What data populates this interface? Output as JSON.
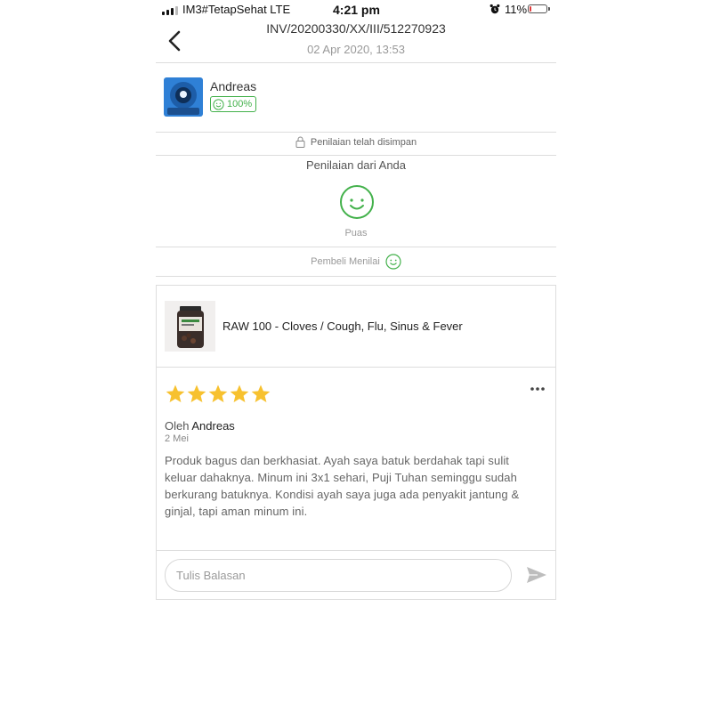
{
  "status_bar": {
    "carrier": "IM3#TetapSehat  LTE",
    "time": "4:21 pm",
    "battery_percent": "11%",
    "battery_level": 0.11,
    "battery_color": "#e23b3b"
  },
  "header": {
    "invoice": "INV/20200330/XX/III/512270923",
    "datetime": "02 Apr 2020, 13:53"
  },
  "seller": {
    "name": "Andreas",
    "score": "100%"
  },
  "rating": {
    "saved_text": "Penilaian telah disimpan",
    "from_you": "Penilaian dari Anda",
    "result": "Puas",
    "buyer_rated": "Pembeli Menilai"
  },
  "review": {
    "product_name": "RAW 100 - Cloves / Cough, Flu, Sinus & Fever",
    "stars": 5,
    "by_prefix": "Oleh",
    "author": "Andreas",
    "date": "2 Mei",
    "text": "Produk bagus dan berkhasiat. Ayah saya batuk berdahak tapi sulit keluar dahaknya. Minum ini 3x1 sehari, Puji Tuhan seminggu sudah berkurang batuknya. Kondisi ayah saya juga ada penyakit jantung & ginjal, tapi aman minum ini."
  },
  "reply": {
    "placeholder": "Tulis Balasan"
  },
  "colors": {
    "accent_green": "#43b14b",
    "star": "#f7c12f"
  }
}
